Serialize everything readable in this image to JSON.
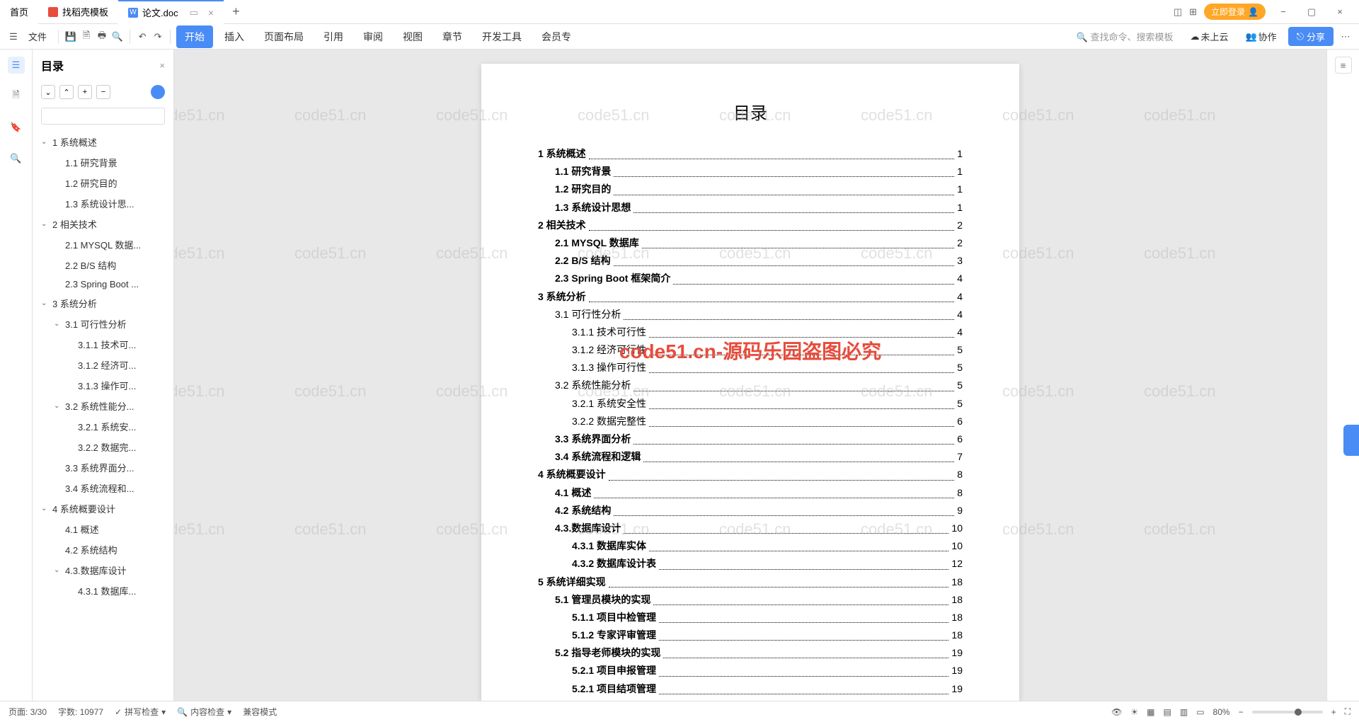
{
  "tabs": {
    "home": "首页",
    "t1": "找稻壳模板",
    "t2": "论文.doc"
  },
  "titlebar_right": {
    "login": "立即登录"
  },
  "toolbar": {
    "file": "文件"
  },
  "menu": {
    "start": "开始",
    "insert": "插入",
    "layout": "页面布局",
    "reference": "引用",
    "review": "审阅",
    "view": "视图",
    "chapter": "章节",
    "devtools": "开发工具",
    "member": "会员专"
  },
  "toolbar_right": {
    "search": "查找命令、搜索模板",
    "cloud": "未上云",
    "collab": "协作",
    "share": "分享"
  },
  "outline": {
    "title": "目录",
    "items": [
      {
        "indent": 0,
        "chev": true,
        "text": "1 系统概述"
      },
      {
        "indent": 1,
        "chev": false,
        "text": "1.1 研究背景"
      },
      {
        "indent": 1,
        "chev": false,
        "text": "1.2 研究目的"
      },
      {
        "indent": 1,
        "chev": false,
        "text": "1.3 系统设计思..."
      },
      {
        "indent": 0,
        "chev": true,
        "text": "2 相关技术"
      },
      {
        "indent": 1,
        "chev": false,
        "text": "2.1 MYSQL 数据..."
      },
      {
        "indent": 1,
        "chev": false,
        "text": "2.2 B/S 结构"
      },
      {
        "indent": 1,
        "chev": false,
        "text": "2.3 Spring Boot ..."
      },
      {
        "indent": 0,
        "chev": true,
        "text": "3 系统分析"
      },
      {
        "indent": 1,
        "chev": true,
        "text": "3.1 可行性分析"
      },
      {
        "indent": 2,
        "chev": false,
        "text": "3.1.1 技术可..."
      },
      {
        "indent": 2,
        "chev": false,
        "text": "3.1.2 经济可..."
      },
      {
        "indent": 2,
        "chev": false,
        "text": "3.1.3 操作可..."
      },
      {
        "indent": 1,
        "chev": true,
        "text": "3.2 系统性能分..."
      },
      {
        "indent": 2,
        "chev": false,
        "text": "3.2.1 系统安..."
      },
      {
        "indent": 2,
        "chev": false,
        "text": "3.2.2 数据完..."
      },
      {
        "indent": 1,
        "chev": false,
        "text": "3.3 系统界面分..."
      },
      {
        "indent": 1,
        "chev": false,
        "text": "3.4 系统流程和..."
      },
      {
        "indent": 0,
        "chev": true,
        "text": "4 系统概要设计"
      },
      {
        "indent": 1,
        "chev": false,
        "text": "4.1 概述"
      },
      {
        "indent": 1,
        "chev": false,
        "text": "4.2 系统结构"
      },
      {
        "indent": 1,
        "chev": true,
        "text": "4.3.数据库设计"
      },
      {
        "indent": 2,
        "chev": false,
        "text": "4.3.1 数据库..."
      }
    ]
  },
  "doc": {
    "title": "目录",
    "toc": [
      {
        "indent": 0,
        "text": "1 系统概述",
        "page": "1"
      },
      {
        "indent": 1,
        "text": "1.1 研究背景",
        "page": "1"
      },
      {
        "indent": 1,
        "text": "1.2 研究目的",
        "page": "1"
      },
      {
        "indent": 1,
        "text": "1.3 系统设计思想",
        "page": "1"
      },
      {
        "indent": 0,
        "text": "2 相关技术",
        "page": "2"
      },
      {
        "indent": 1,
        "text": "2.1 MYSQL 数据库",
        "page": "2"
      },
      {
        "indent": 1,
        "text": "2.2 B/S 结构",
        "page": "3"
      },
      {
        "indent": 1,
        "text": "2.3 Spring Boot 框架简介",
        "page": "4"
      },
      {
        "indent": 0,
        "text": "3 系统分析",
        "page": "4"
      },
      {
        "indent": 1,
        "text": "3.1 可行性分析",
        "page": "4"
      },
      {
        "indent": 2,
        "text": "3.1.1 技术可行性",
        "page": "4"
      },
      {
        "indent": 2,
        "text": "3.1.2 经济可行性",
        "page": "5"
      },
      {
        "indent": 2,
        "text": "3.1.3 操作可行性",
        "page": "5"
      },
      {
        "indent": 1,
        "text": "3.2 系统性能分析",
        "page": "5"
      },
      {
        "indent": 2,
        "text": "3.2.1 系统安全性",
        "page": "5"
      },
      {
        "indent": 2,
        "text": "3.2.2 数据完整性",
        "page": "6"
      },
      {
        "indent": 1,
        "text": "3.3 系统界面分析",
        "page": "6"
      },
      {
        "indent": 1,
        "text": "3.4 系统流程和逻辑",
        "page": "7"
      },
      {
        "indent": 0,
        "text": "4 系统概要设计",
        "page": "8"
      },
      {
        "indent": 1,
        "text": "4.1 概述",
        "page": "8"
      },
      {
        "indent": 1,
        "text": "4.2 系统结构",
        "page": "9"
      },
      {
        "indent": 1,
        "text": "4.3.数据库设计",
        "page": "10"
      },
      {
        "indent": 2,
        "text": "4.3.1 数据库实体",
        "page": "10"
      },
      {
        "indent": 2,
        "text": "4.3.2 数据库设计表",
        "page": "12"
      },
      {
        "indent": 0,
        "text": "5 系统详细实现",
        "page": "18"
      },
      {
        "indent": 1,
        "text": "5.1 管理员模块的实现",
        "page": "18"
      },
      {
        "indent": 2,
        "text": "5.1.1 项目中检管理",
        "page": "18"
      },
      {
        "indent": 2,
        "text": "5.1.2 专家评审管理",
        "page": "18"
      },
      {
        "indent": 1,
        "text": "5.2 指导老师模块的实现",
        "page": "19"
      },
      {
        "indent": 2,
        "text": "5.2.1 项目申报管理",
        "page": "19"
      },
      {
        "indent": 2,
        "text": "5.2.1 项目结项管理",
        "page": "19"
      }
    ]
  },
  "watermark_text": "code51.cn",
  "watermark_red": "code51.cn-源码乐园盗图必究",
  "statusbar": {
    "page": "页面: 3/30",
    "words": "字数: 10977",
    "spell": "拼写检查",
    "content": "内容检查",
    "compat": "兼容模式",
    "zoom": "80%"
  }
}
